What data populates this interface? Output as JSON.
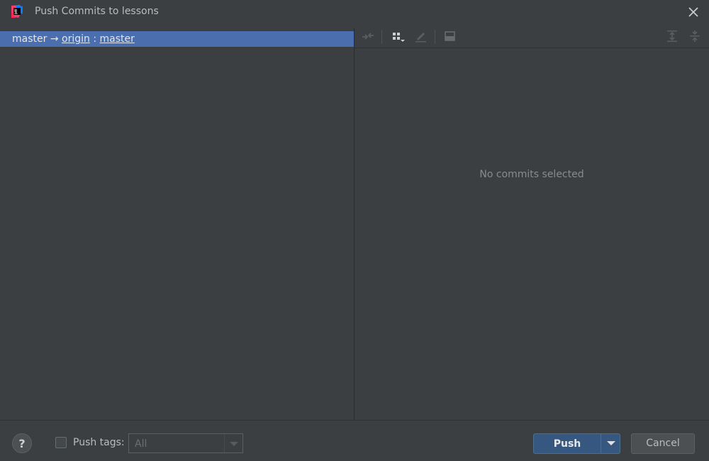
{
  "window": {
    "title": "Push Commits to lessons",
    "app_icon": "intellij-idea-icon",
    "close_icon": "close-icon"
  },
  "branch_row": {
    "local_branch": "master",
    "arrow": "→",
    "remote": "origin",
    "separator": ":",
    "remote_branch": "master"
  },
  "details_toolbar": {
    "icons": [
      "cherry-pick-icon",
      "group-by-icon",
      "edit-icon",
      "preview-icon",
      "expand-all-icon",
      "collapse-all-icon"
    ]
  },
  "details": {
    "empty_text": "No commits selected"
  },
  "footer": {
    "help_label": "?",
    "push_tags_label": "Push tags:",
    "push_tags_checked": false,
    "tags_select_value": "All",
    "push_label": "Push",
    "cancel_label": "Cancel"
  },
  "colors": {
    "background": "#3c3f41",
    "selection": "#4b6eaf",
    "primary_button": "#365880"
  }
}
